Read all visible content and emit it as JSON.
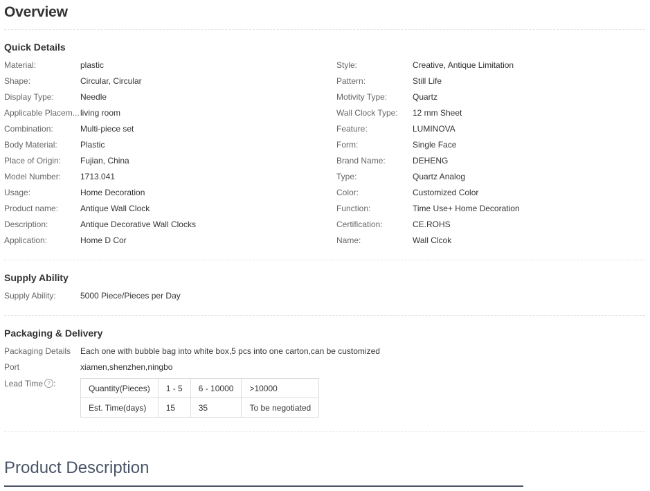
{
  "overview": {
    "title": "Overview"
  },
  "quick_details": {
    "title": "Quick Details",
    "left": [
      {
        "label": "Material:",
        "value": "plastic"
      },
      {
        "label": "Shape:",
        "value": "Circular, Circular"
      },
      {
        "label": "Display Type:",
        "value": "Needle"
      },
      {
        "label": "Applicable Placem...",
        "value": "living room"
      },
      {
        "label": "Combination:",
        "value": "Multi-piece set"
      },
      {
        "label": "Body Material:",
        "value": "Plastic"
      },
      {
        "label": "Place of Origin:",
        "value": "Fujian, China"
      },
      {
        "label": "Model Number:",
        "value": "1713.041"
      },
      {
        "label": "Usage:",
        "value": "Home Decoration"
      },
      {
        "label": "Product name:",
        "value": "Antique Wall Clock"
      },
      {
        "label": "Description:",
        "value": "Antique Decorative Wall Clocks"
      },
      {
        "label": "Application:",
        "value": "Home D Cor"
      }
    ],
    "right": [
      {
        "label": "Style:",
        "value": "Creative, Antique Limitation"
      },
      {
        "label": "Pattern:",
        "value": "Still Life"
      },
      {
        "label": "Motivity Type:",
        "value": "Quartz"
      },
      {
        "label": "Wall Clock Type:",
        "value": "12 mm Sheet"
      },
      {
        "label": "Feature:",
        "value": "LUMINOVA"
      },
      {
        "label": "Form:",
        "value": "Single Face"
      },
      {
        "label": "Brand Name:",
        "value": "DEHENG"
      },
      {
        "label": "Type:",
        "value": "Quartz Analog"
      },
      {
        "label": "Color:",
        "value": "Customized Color"
      },
      {
        "label": "Function:",
        "value": "Time Use+ Home Decoration"
      },
      {
        "label": "Certification:",
        "value": "CE.ROHS"
      },
      {
        "label": "Name:",
        "value": "Wall Clcok"
      }
    ]
  },
  "supply_ability": {
    "title": "Supply Ability",
    "label": "Supply Ability:",
    "value": "5000 Piece/Pieces per Day"
  },
  "packaging": {
    "title": "Packaging & Delivery",
    "details_label": "Packaging Details",
    "details_value": "Each one with bubble bag into white box,5 pcs into one carton,can be customized",
    "port_label": "Port",
    "port_value": "xiamen,shenzhen,ningbo",
    "lead_time_label": "Lead Time",
    "lead_time_suffix": ":",
    "help_icon_glyph": "?",
    "lead_table": {
      "rows": [
        [
          "Quantity(Pieces)",
          "1 - 5",
          "6 - 10000",
          ">10000"
        ],
        [
          "Est. Time(days)",
          "15",
          "35",
          "To be negotiated"
        ]
      ]
    }
  },
  "product_description": {
    "title": "Product Description"
  }
}
